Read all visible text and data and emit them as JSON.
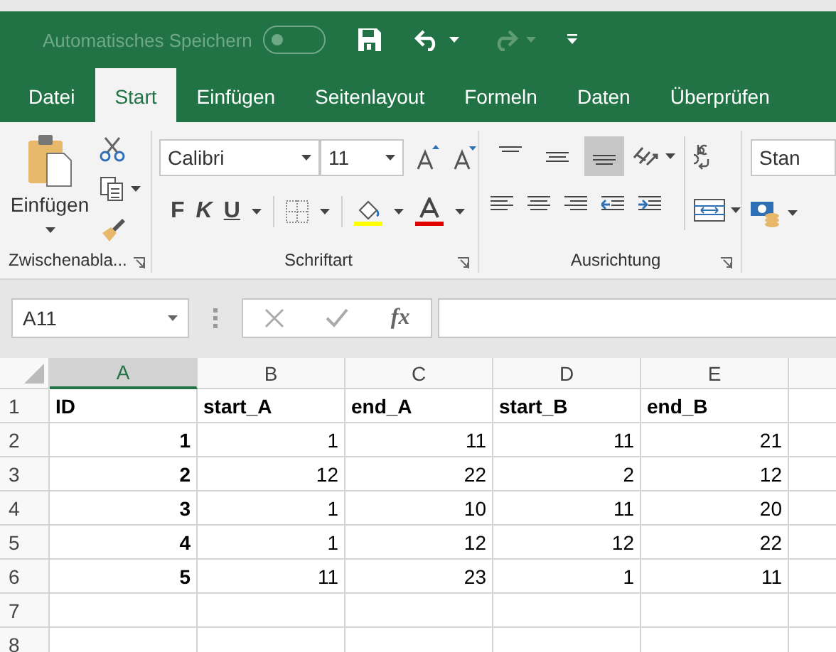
{
  "quick_access": {
    "autosave_label": "Automatisches Speichern",
    "autosave_on": false
  },
  "tabs": [
    {
      "label": "Datei",
      "selected": false
    },
    {
      "label": "Start",
      "selected": true
    },
    {
      "label": "Einfügen",
      "selected": false
    },
    {
      "label": "Seitenlayout",
      "selected": false
    },
    {
      "label": "Formeln",
      "selected": false
    },
    {
      "label": "Daten",
      "selected": false
    },
    {
      "label": "Überprüfen",
      "selected": false
    }
  ],
  "ribbon": {
    "clipboard": {
      "paste_label": "Einfügen",
      "group_label": "Zwischenabla..."
    },
    "font": {
      "font_name": "Calibri",
      "font_size": "11",
      "bold": "F",
      "italic": "K",
      "underline": "U",
      "group_label": "Schriftart"
    },
    "alignment": {
      "vertical_buttons": [
        {
          "kind": "top",
          "selected": false
        },
        {
          "kind": "middle",
          "selected": false
        },
        {
          "kind": "bottom",
          "selected": true
        }
      ],
      "group_label": "Ausrichtung"
    },
    "number": {
      "format": "Stan"
    }
  },
  "formula_bar": {
    "name_box": "A11",
    "function_label": "fx"
  },
  "sheet": {
    "columns": [
      {
        "label": "A",
        "selected": true
      },
      {
        "label": "B",
        "selected": false
      },
      {
        "label": "C",
        "selected": false
      },
      {
        "label": "D",
        "selected": false
      },
      {
        "label": "E",
        "selected": false
      }
    ],
    "rows": [
      {
        "header": "1",
        "cells": [
          {
            "text": "ID",
            "kind": "text",
            "bold": true
          },
          {
            "text": "start_A",
            "kind": "text",
            "bold": true
          },
          {
            "text": "end_A",
            "kind": "text",
            "bold": true
          },
          {
            "text": "start_B",
            "kind": "text",
            "bold": true
          },
          {
            "text": "end_B",
            "kind": "text",
            "bold": true
          }
        ]
      },
      {
        "header": "2",
        "cells": [
          {
            "text": "1",
            "kind": "number",
            "bold": true
          },
          {
            "text": "1",
            "kind": "number",
            "bold": false
          },
          {
            "text": "11",
            "kind": "number",
            "bold": false
          },
          {
            "text": "11",
            "kind": "number",
            "bold": false
          },
          {
            "text": "21",
            "kind": "number",
            "bold": false
          }
        ]
      },
      {
        "header": "3",
        "cells": [
          {
            "text": "2",
            "kind": "number",
            "bold": true
          },
          {
            "text": "12",
            "kind": "number",
            "bold": false
          },
          {
            "text": "22",
            "kind": "number",
            "bold": false
          },
          {
            "text": "2",
            "kind": "number",
            "bold": false
          },
          {
            "text": "12",
            "kind": "number",
            "bold": false
          }
        ]
      },
      {
        "header": "4",
        "cells": [
          {
            "text": "3",
            "kind": "number",
            "bold": true
          },
          {
            "text": "1",
            "kind": "number",
            "bold": false
          },
          {
            "text": "10",
            "kind": "number",
            "bold": false
          },
          {
            "text": "11",
            "kind": "number",
            "bold": false
          },
          {
            "text": "20",
            "kind": "number",
            "bold": false
          }
        ]
      },
      {
        "header": "5",
        "cells": [
          {
            "text": "4",
            "kind": "number",
            "bold": true
          },
          {
            "text": "1",
            "kind": "number",
            "bold": false
          },
          {
            "text": "12",
            "kind": "number",
            "bold": false
          },
          {
            "text": "12",
            "kind": "number",
            "bold": false
          },
          {
            "text": "22",
            "kind": "number",
            "bold": false
          }
        ]
      },
      {
        "header": "6",
        "cells": [
          {
            "text": "5",
            "kind": "number",
            "bold": true
          },
          {
            "text": "11",
            "kind": "number",
            "bold": false
          },
          {
            "text": "23",
            "kind": "number",
            "bold": false
          },
          {
            "text": "1",
            "kind": "number",
            "bold": false
          },
          {
            "text": "11",
            "kind": "number",
            "bold": false
          }
        ]
      },
      {
        "header": "7",
        "cells": []
      },
      {
        "header": "8",
        "cells": []
      }
    ]
  }
}
